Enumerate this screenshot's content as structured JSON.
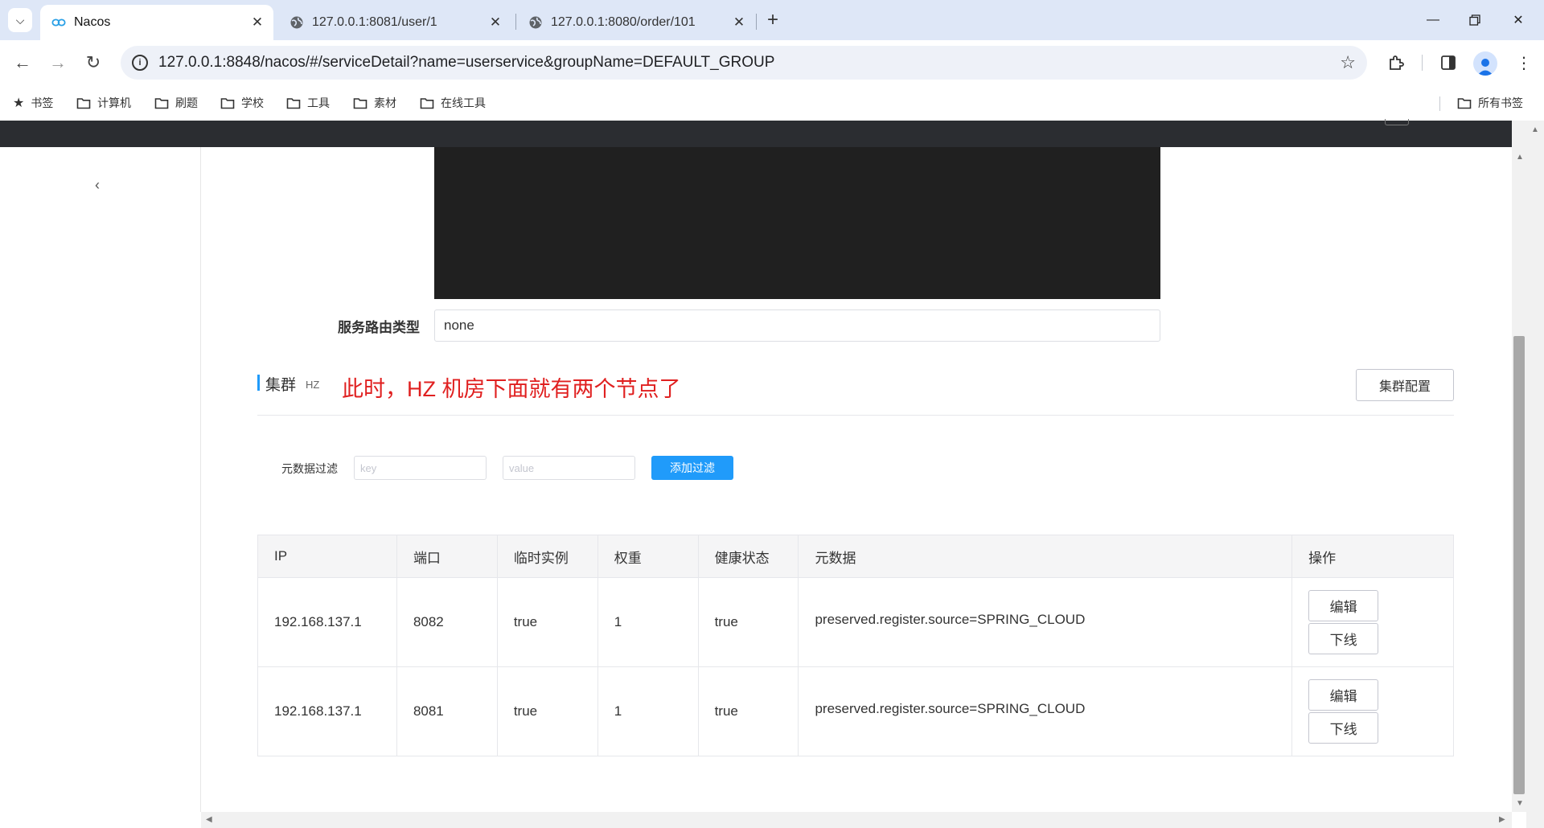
{
  "browser": {
    "tabs": [
      {
        "title": "Nacos",
        "active": true
      },
      {
        "title": "127.0.0.1:8081/user/1",
        "active": false
      },
      {
        "title": "127.0.0.1:8080/order/101",
        "active": false
      }
    ],
    "url": "127.0.0.1:8848/nacos/#/serviceDetail?name=userservice&groupName=DEFAULT_GROUP",
    "bookmarks": [
      "书签",
      "计算机",
      "刷题",
      "学校",
      "工具",
      "素材",
      "在线工具"
    ],
    "all_bookmarks": "所有书签"
  },
  "service": {
    "route_label": "服务路由类型",
    "route_value": "none"
  },
  "cluster": {
    "title": "集群",
    "name": "HZ",
    "annotation": "此时，HZ 机房下面就有两个节点了",
    "config_button": "集群配置"
  },
  "filter": {
    "label": "元数据过滤",
    "key_placeholder": "key",
    "value_placeholder": "value",
    "add_button": "添加过滤"
  },
  "table": {
    "headers": [
      "IP",
      "端口",
      "临时实例",
      "权重",
      "健康状态",
      "元数据",
      "操作"
    ],
    "rows": [
      {
        "ip": "192.168.137.1",
        "port": "8082",
        "ephemeral": "true",
        "weight": "1",
        "healthy": "true",
        "metadata": "preserved.register.source=SPRING_CLOUD"
      },
      {
        "ip": "192.168.137.1",
        "port": "8081",
        "ephemeral": "true",
        "weight": "1",
        "healthy": "true",
        "metadata": "preserved.register.source=SPRING_CLOUD"
      }
    ],
    "edit_label": "编辑",
    "offline_label": "下线"
  },
  "colors": {
    "accent": "#209bfa",
    "annotation": "#e02020",
    "header_bg": "#2b2d31",
    "editor_bg": "#202020"
  }
}
